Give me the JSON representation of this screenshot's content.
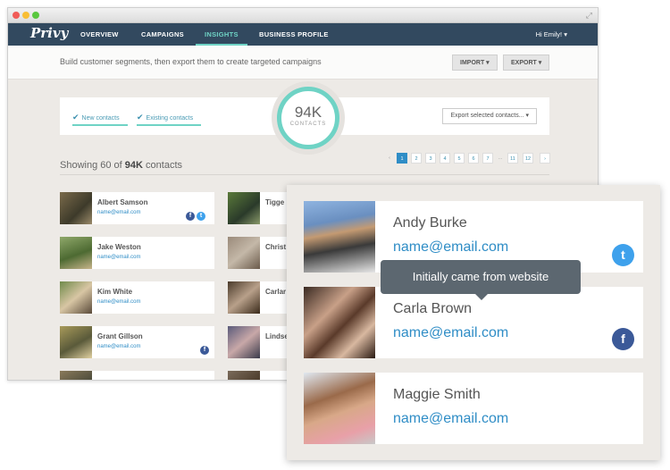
{
  "app": {
    "logo": "Privy"
  },
  "nav": {
    "items": [
      {
        "label": "OVERVIEW"
      },
      {
        "label": "CAMPAIGNS"
      },
      {
        "label": "INSIGHTS"
      },
      {
        "label": "BUSINESS PROFILE"
      }
    ],
    "user": "Hi Emily! ▾"
  },
  "subheader": {
    "text": "Build customer segments, then export them to create targeted campaigns",
    "import_label": "IMPORT ▾",
    "export_label": "EXPORT ▾"
  },
  "filters": {
    "new_contacts": "New contacts",
    "existing_contacts": "Existing contacts",
    "export_selected": "Export selected contacts...  ▾"
  },
  "stats": {
    "total": "94K",
    "label": "CONTACTS"
  },
  "showing": {
    "prefix": "Showing 60 of",
    "count": "94K",
    "suffix": "contacts"
  },
  "pagination": [
    "‹",
    "1",
    "2",
    "3",
    "4",
    "5",
    "6",
    "7",
    "...",
    "11",
    "12",
    "›"
  ],
  "contacts_left": [
    {
      "name": "Albert Samson",
      "email": "name@email.com"
    },
    {
      "name": "Jake Weston",
      "email": "name@email.com"
    },
    {
      "name": "Kim White",
      "email": "name@email.com"
    },
    {
      "name": "Grant Gillson",
      "email": "name@email.com"
    }
  ],
  "contacts_right": [
    {
      "name": "Tigge"
    },
    {
      "name": "Christ"
    },
    {
      "name": "Carlar"
    },
    {
      "name": "Lindse"
    }
  ],
  "zoom_cards": [
    {
      "name": "Andy Burke",
      "email": "name@email.com"
    },
    {
      "name": "Carla Brown",
      "email": "name@email.com"
    },
    {
      "name": "Maggie Smith",
      "email": "name@email.com"
    }
  ],
  "tooltip": "Initially came from website",
  "icons": {
    "facebook": "f",
    "twitter": "t"
  },
  "colors": {
    "navbar": "#32495f",
    "accent": "#6fd3c5",
    "link": "#2f8dc6"
  }
}
